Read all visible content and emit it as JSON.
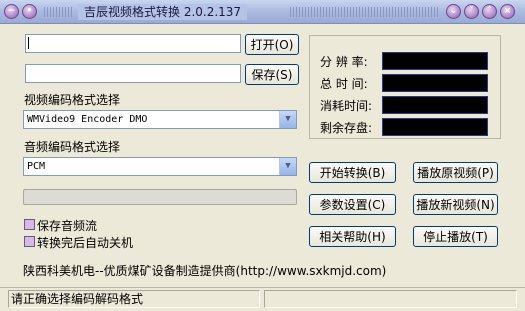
{
  "window": {
    "title": "吉辰视频格式转换 2.0.2.137",
    "left_buttons": [
      "menu-icon",
      "pin-icon"
    ],
    "right_buttons": [
      "shade-icon",
      "minimize-icon",
      "maximize-icon",
      "close-icon"
    ]
  },
  "files": {
    "input_value": "",
    "open_label": "打开(O)",
    "output_value": "",
    "save_label": "保存(S)"
  },
  "video": {
    "label": "视频编码格式选择",
    "selected": "WMVideo9 Encoder DMO"
  },
  "audio": {
    "label": "音频编码格式选择",
    "selected": "PCM"
  },
  "progress": {
    "value": 0
  },
  "options": {
    "save_audio": "保存音频流",
    "auto_shutdown": "转换完后自动关机"
  },
  "info": {
    "resolution_label": "分 辨 率:",
    "total_time_label": "总 时 间:",
    "elapsed_label": "消耗时间:",
    "free_space_label": "剩余存盘:",
    "resolution_value": "",
    "total_time_value": "",
    "elapsed_value": "",
    "free_space_value": ""
  },
  "buttons": {
    "start": "开始转换(B)",
    "play_original": "播放原视频(P)",
    "settings": "参数设置(C)",
    "play_new": "播放新视频(N)",
    "help": "相关帮助(H)",
    "stop": "停止播放(T)"
  },
  "footer": {
    "text": "陕西科美机电--优质煤矿设备制造提供商(http://www.sxkmjd.com)"
  },
  "statusbar": {
    "message": "请正确选择编码解码格式",
    "secondary": ""
  }
}
